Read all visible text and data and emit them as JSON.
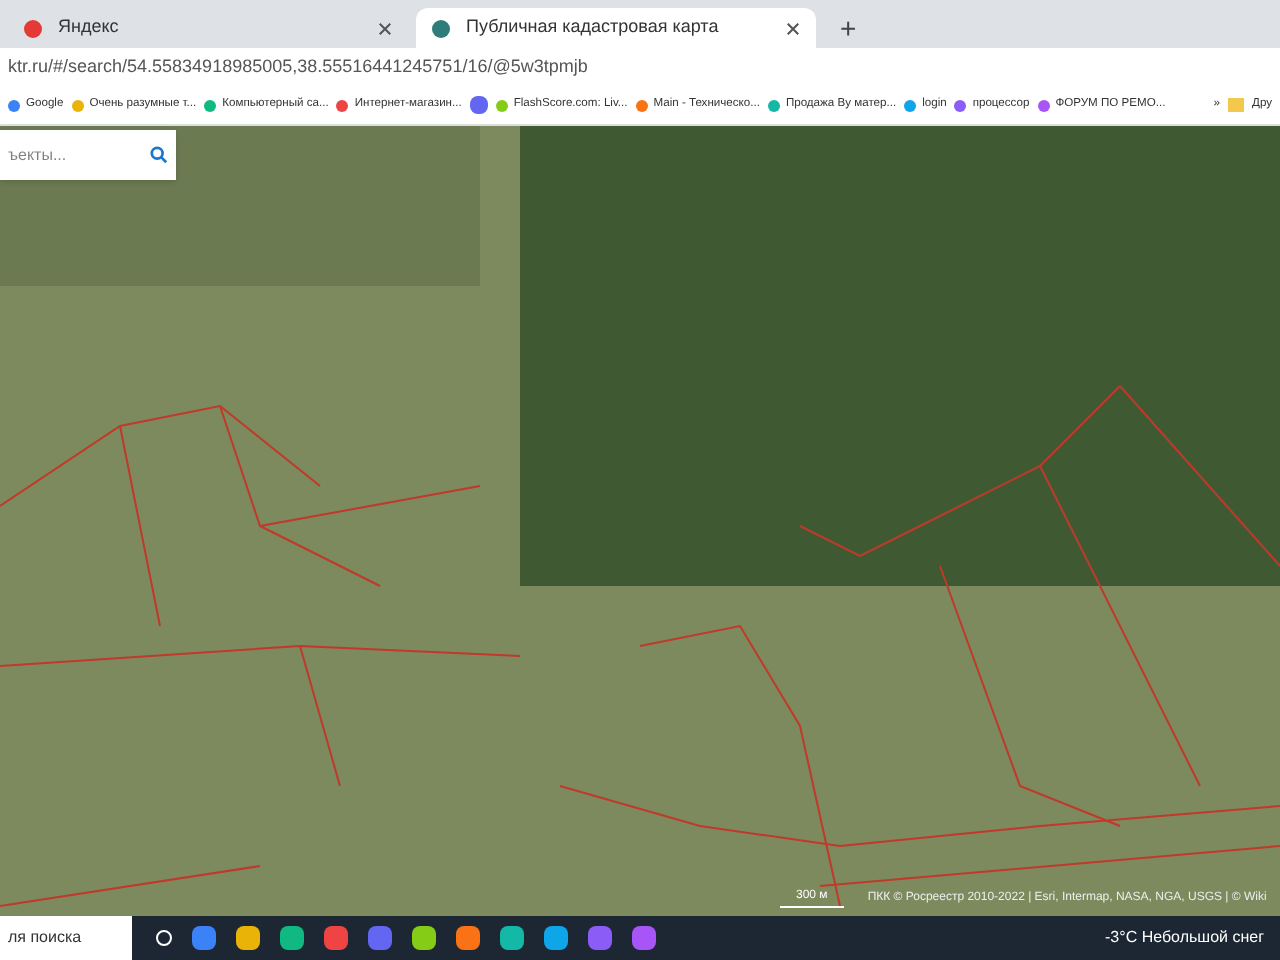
{
  "tabs": [
    {
      "label": "Яндекс",
      "selected": false
    },
    {
      "label": "Публичная кадастровая карта",
      "selected": true
    }
  ],
  "new_tab": "+",
  "address_bar": {
    "value": "ktr.ru/#/search/54.55834918985005,38.55516441245751/16/@5w3tpmjb"
  },
  "bookmarks": [
    {
      "label": "Google"
    },
    {
      "label": "Очень разумные т..."
    },
    {
      "label": "Компьютерный са..."
    },
    {
      "label": "Интернет-магазин..."
    },
    {
      "kind": "icon"
    },
    {
      "label": "FlashScore.com: Liv..."
    },
    {
      "label": "Main - Техническо..."
    },
    {
      "label": "Продажа By матер..."
    },
    {
      "label": "login"
    },
    {
      "label": "процессор"
    },
    {
      "label": "ФОРУМ ПО РЕМО..."
    }
  ],
  "bookmarks_more": "»",
  "bookmarks_folder": "Дру",
  "map": {
    "search": {
      "placeholder": "ъекты..."
    },
    "scale": "300 м",
    "attribution": "ПКК © Росреестр 2010-2022 | Esri, Intermap, NASA, NGA, USGS | © Wiki"
  },
  "taskbar": {
    "search": {
      "placeholder": "ля поиска"
    },
    "weather": "-3°C  Небольшой снег"
  }
}
